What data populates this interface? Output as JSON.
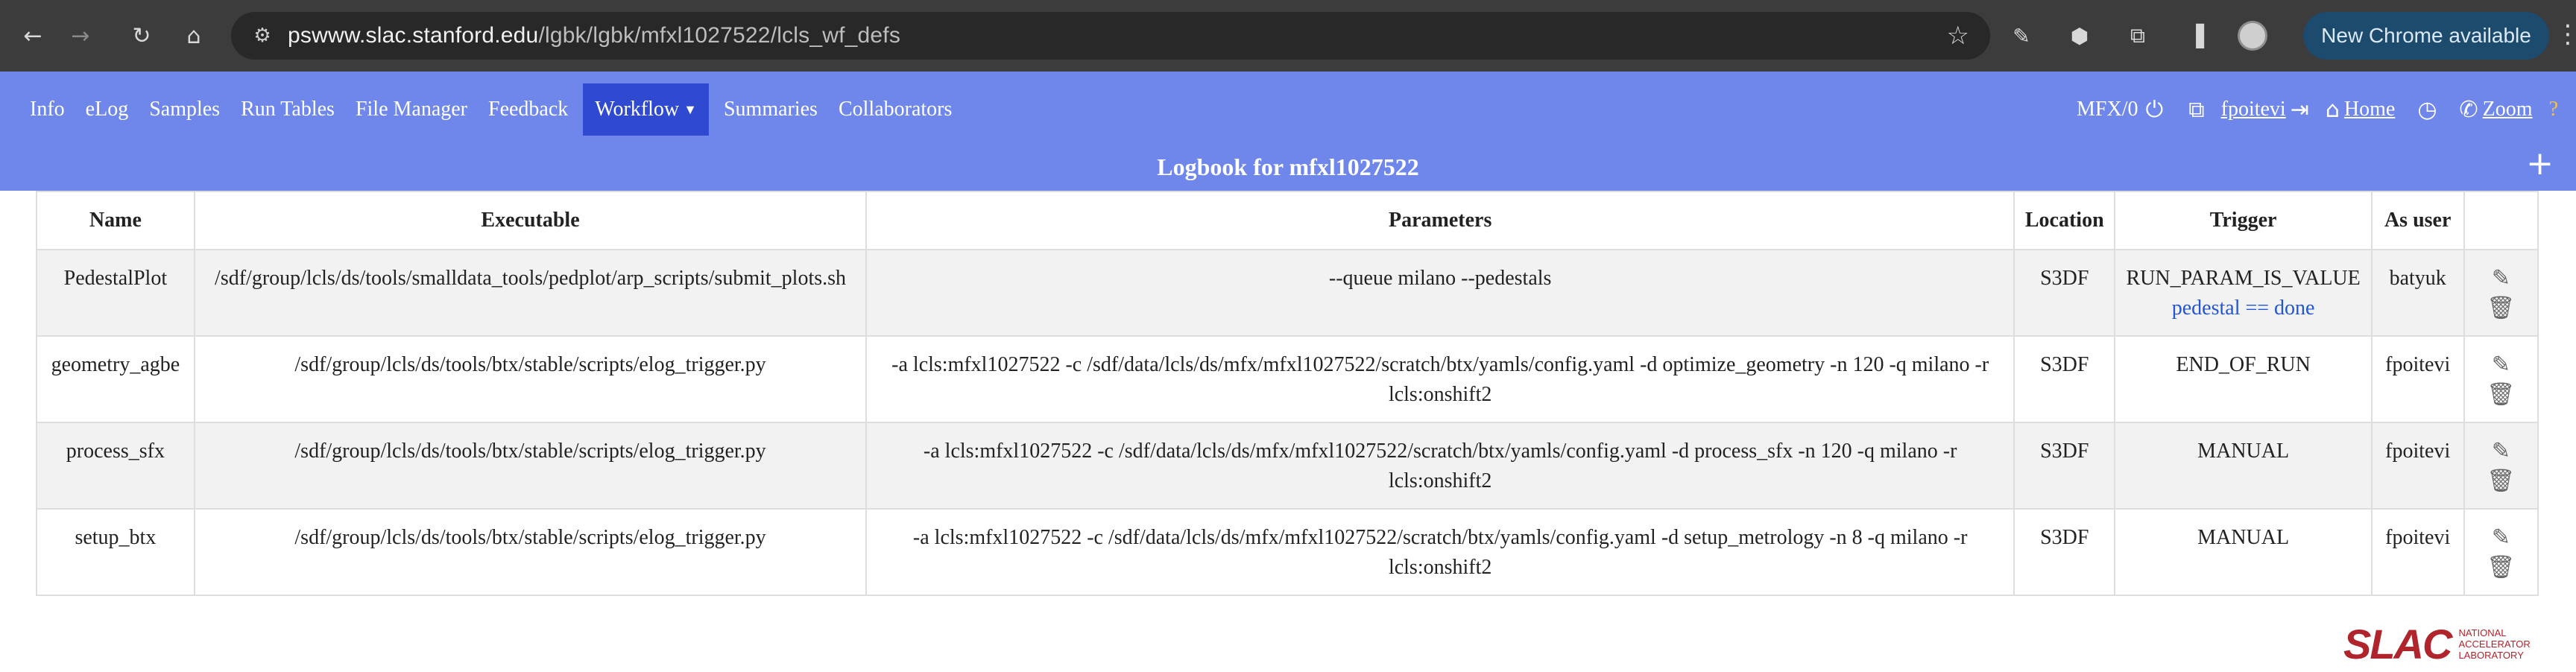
{
  "browser": {
    "url_host": "pswww.slac.stanford.edu",
    "url_path": "/lgbk/lgbk/mfxl1027522/lcls_wf_defs",
    "new_chrome_label": "New Chrome available"
  },
  "nav": {
    "links": [
      "Info",
      "eLog",
      "Samples",
      "Run Tables",
      "File Manager",
      "Feedback",
      "Workflow",
      "Summaries",
      "Collaborators"
    ],
    "active": "Workflow",
    "instrument": "MFX/0",
    "user": "fpoitevi",
    "home": "Home",
    "zoom": "Zoom"
  },
  "page": {
    "title": "Logbook for mfxl1027522"
  },
  "table": {
    "headers": [
      "Name",
      "Executable",
      "Parameters",
      "Location",
      "Trigger",
      "As user"
    ],
    "rows": [
      {
        "name": "PedestalPlot",
        "executable": "/sdf/group/lcls/ds/tools/smalldata_tools/pedplot/arp_scripts/submit_plots.sh",
        "parameters": "--queue milano --pedestals",
        "location": "S3DF",
        "trigger": "RUN_PARAM_IS_VALUE",
        "trigger_condition": "pedestal == done",
        "as_user": "batyuk"
      },
      {
        "name": "geometry_agbe",
        "executable": "/sdf/group/lcls/ds/tools/btx/stable/scripts/elog_trigger.py",
        "parameters": "-a lcls:mfxl1027522 -c /sdf/data/lcls/ds/mfx/mfxl1027522/scratch/btx/yamls/config.yaml -d optimize_geometry -n 120 -q milano -r lcls:onshift2",
        "location": "S3DF",
        "trigger": "END_OF_RUN",
        "trigger_condition": "",
        "as_user": "fpoitevi"
      },
      {
        "name": "process_sfx",
        "executable": "/sdf/group/lcls/ds/tools/btx/stable/scripts/elog_trigger.py",
        "parameters": "-a lcls:mfxl1027522 -c /sdf/data/lcls/ds/mfx/mfxl1027522/scratch/btx/yamls/config.yaml -d process_sfx -n 120 -q milano -r lcls:onshift2",
        "location": "S3DF",
        "trigger": "MANUAL",
        "trigger_condition": "",
        "as_user": "fpoitevi"
      },
      {
        "name": "setup_btx",
        "executable": "/sdf/group/lcls/ds/tools/btx/stable/scripts/elog_trigger.py",
        "parameters": "-a lcls:mfxl1027522 -c /sdf/data/lcls/ds/mfx/mfxl1027522/scratch/btx/yamls/config.yaml -d setup_metrology -n 8 -q milano -r lcls:onshift2",
        "location": "S3DF",
        "trigger": "MANUAL",
        "trigger_condition": "",
        "as_user": "fpoitevi"
      }
    ]
  },
  "logo": {
    "word": "SLAC",
    "sub_lines": [
      "NATIONAL",
      "ACCELERATOR",
      "LABORATORY"
    ]
  },
  "colors": {
    "nav_bg": "#6f87ea",
    "nav_active": "#2f49d1",
    "condition_text": "#2255d6",
    "logo": "#b0242c"
  }
}
